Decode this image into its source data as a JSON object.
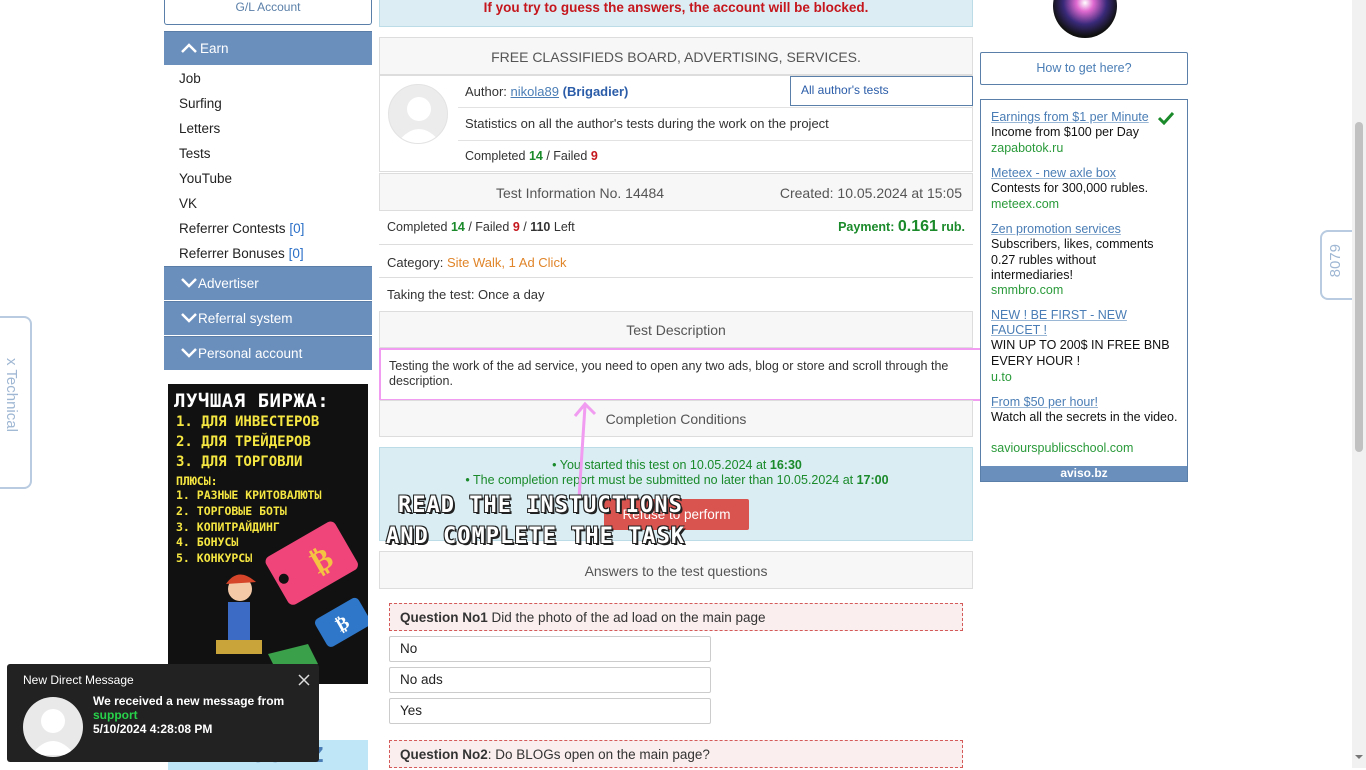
{
  "sidebar": {
    "gl_account": "G/L Account",
    "earn_label": "Earn",
    "items": [
      {
        "label": "Job",
        "count": ""
      },
      {
        "label": "Surfing",
        "count": ""
      },
      {
        "label": "Letters",
        "count": ""
      },
      {
        "label": "Tests",
        "count": ""
      },
      {
        "label": "YouTube",
        "count": ""
      },
      {
        "label": "VK",
        "count": ""
      },
      {
        "label": "Referrer Contests",
        "count": "[0]"
      },
      {
        "label": "Referrer Bonuses",
        "count": "[0]"
      }
    ],
    "advertiser_label": "Advertiser",
    "referral_label": "Referral system",
    "personal_label": "Personal account",
    "banner": {
      "title": "ЛУЧШАЯ БИРЖА:",
      "lines": [
        "1. ДЛЯ ИНВЕСТЕРОВ",
        "2. ДЛЯ ТРЕЙДЕРОВ",
        "3. ДЛЯ ТОРГОВЛИ"
      ],
      "plus_title": "ПЛЮСЫ:",
      "plus": [
        "1. РАЗНЫЕ КРИТОВАЛЮТЫ",
        "2. ТОРГОВЫЕ БОТЫ",
        "3. КОПИТРАЙДИНГ",
        "4. БОНУСЫ",
        "5. КОНКУРСЫ"
      ]
    },
    "aviso_logo": "AVISO.BZ"
  },
  "main": {
    "warning": "If you try to guess the answers, the account will be blocked.",
    "board_title": "FREE CLASSIFIEDS BOARD, ADVERTISING, SERVICES.",
    "author_label": "Author:",
    "author_name": "nikola89",
    "author_rank": "(Brigadier)",
    "all_tests_button": "All author's tests",
    "stats_text": "Statistics on all the author's tests during the work on the project",
    "author_completed_label": "Completed",
    "author_completed": "14",
    "author_failed_label": "/ Failed",
    "author_failed": "9",
    "test_info": "Test Information No. 14484",
    "created": "Created: 10.05.2024 at 15:05",
    "completed_label": "Completed",
    "completed": "14",
    "failed_label": "/ Failed",
    "failed": "9",
    "sep": "/",
    "left": "110",
    "left_label": "Left",
    "payment_label": "Payment:",
    "payment": "0.161",
    "payment_unit": "rub.",
    "category_label": "Category:",
    "category": "Site Walk, 1 Ad Click",
    "taking": "Taking the test: Once a day",
    "description_header": "Test Description",
    "description": "Testing the work of the ad service, you need to open any two ads, blog or store and scroll through the description.",
    "conditions_header": "Completion Conditions",
    "started_prefix": "• You started this test on 10.05.2024 at",
    "started_time": "16:30",
    "deadline_prefix": "• The completion report must be submitted no later than 10.05.2024 at",
    "deadline_time": "17:00",
    "refuse_button": "Refuse to perform",
    "answers_header": "Answers to the test questions",
    "q1_num": "Question No1",
    "q1_text": "Did the photo of the ad load on the main page",
    "q1_options": [
      "No",
      "No ads",
      "Yes"
    ],
    "q2_num": "Question No2",
    "q2_text": ": Do BLOGs open on the main page?"
  },
  "overlay": {
    "line1": "READ THE INSTUCTIONS",
    "line2": "AND COMPLETE THE TASK"
  },
  "right": {
    "how_to": "How to get here?",
    "ads": [
      {
        "title": "Earnings from $1 per Minute",
        "text": "Income from $100 per Day",
        "url": "zapabotok.ru"
      },
      {
        "title": "Meteex - new axle box",
        "text": "Contests for 300,000 rubles.",
        "url": "meteex.com"
      },
      {
        "title": "Zen promotion services",
        "text": "Subscribers, likes, comments 0.27 rubles without intermediaries!",
        "url": "smmbro.com"
      },
      {
        "title": "NEW ! BE FIRST - NEW FAUCET !",
        "text": "WIN UP TO 200$ IN FREE BNB EVERY HOUR !",
        "url": "u.to"
      },
      {
        "title": "From $50 per hour!",
        "text": "Watch all the secrets in the video.",
        "url": "saviourspublicschool.com"
      }
    ],
    "footer": "aviso.bz"
  },
  "side_tabs": {
    "left": "x Technical",
    "right": "8079"
  },
  "toast": {
    "title": "New Direct Message",
    "line1": "We received a new message from",
    "sender": "support",
    "time": "5/10/2024 4:28:08 PM"
  },
  "colors": {
    "accent": "#6a8fbd",
    "green": "#1a8a2a",
    "red": "#c4161c",
    "refuse": "#d9534f"
  }
}
